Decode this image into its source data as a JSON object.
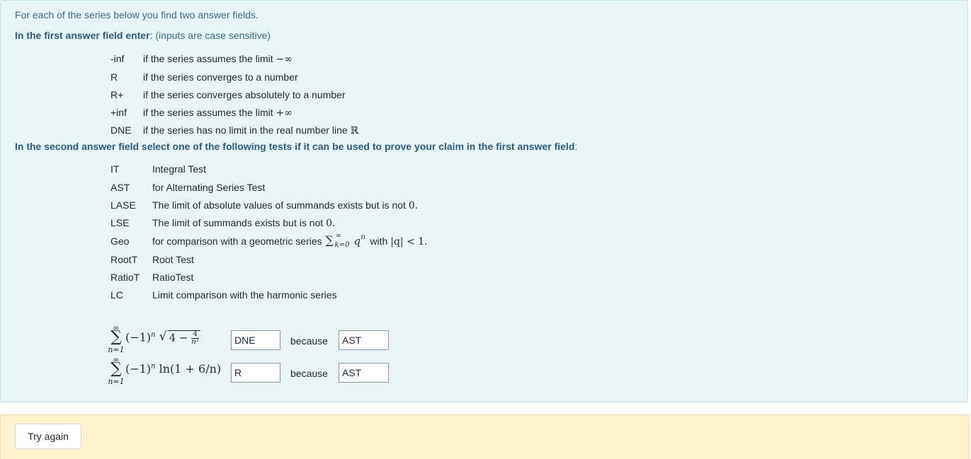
{
  "intro_text": "For each of the series below you find two answer fields.",
  "first_field": {
    "heading_bold": "In the first answer field enter",
    "heading_rest": ": (inputs are case sensitive)",
    "codes": [
      {
        "code": "-inf",
        "desc": "if the series assumes the limit",
        "math": "−∞"
      },
      {
        "code": "R",
        "desc": "if the series converges to a number",
        "math": ""
      },
      {
        "code": "R+",
        "desc": "if the series converges absolutely to a number",
        "math": ""
      },
      {
        "code": "+inf",
        "desc": "if the series assumes the limit",
        "math": "+∞"
      },
      {
        "code": "DNE",
        "desc": "if the series has no limit in the real number line",
        "math": "ℝ"
      }
    ]
  },
  "second_field": {
    "heading_bold": "In the second answer field select one of the following tests if it can be used to prove your claim in the first answer field",
    "heading_rest": ":",
    "tests": [
      {
        "code": "IT",
        "desc": "Integral Test"
      },
      {
        "code": "AST",
        "desc": "for Alternating Series Test"
      },
      {
        "code": "LASE",
        "desc": "The limit of absolute values of summands exists but is not",
        "math": "0."
      },
      {
        "code": "LSE",
        "desc": "The limit of summands exists but is not",
        "math": "0."
      },
      {
        "code": "Geo",
        "desc": "for comparison with a geometric series",
        "math_sum": "∑",
        "math_sum_sup": "∞",
        "math_sum_sub": "k=0",
        "math_q": "q",
        "math_n": "n",
        "desc_mid": "with",
        "math_cond": "|q| < 1."
      },
      {
        "code": "RootT",
        "desc": "Root Test"
      },
      {
        "code": "RatioT",
        "desc": "RatioTest"
      },
      {
        "code": "LC",
        "desc": "Limit comparison with the harmonic series"
      }
    ]
  },
  "problems": [
    {
      "sum_sup": "∞",
      "sum_sub": "n=1",
      "term_prefix": "(−1)",
      "term_exp": "n",
      "term_body": "√(4 − 4/n²)",
      "answer1": "DNE",
      "because": "because",
      "answer2": "AST"
    },
    {
      "sum_sup": "∞",
      "sum_sub": "n=1",
      "term_prefix": "(−1)",
      "term_exp": "n",
      "term_body": " ln(1 + 6/n)",
      "answer1": "R",
      "because": "because",
      "answer2": "AST"
    }
  ],
  "try_again_label": "Try again"
}
